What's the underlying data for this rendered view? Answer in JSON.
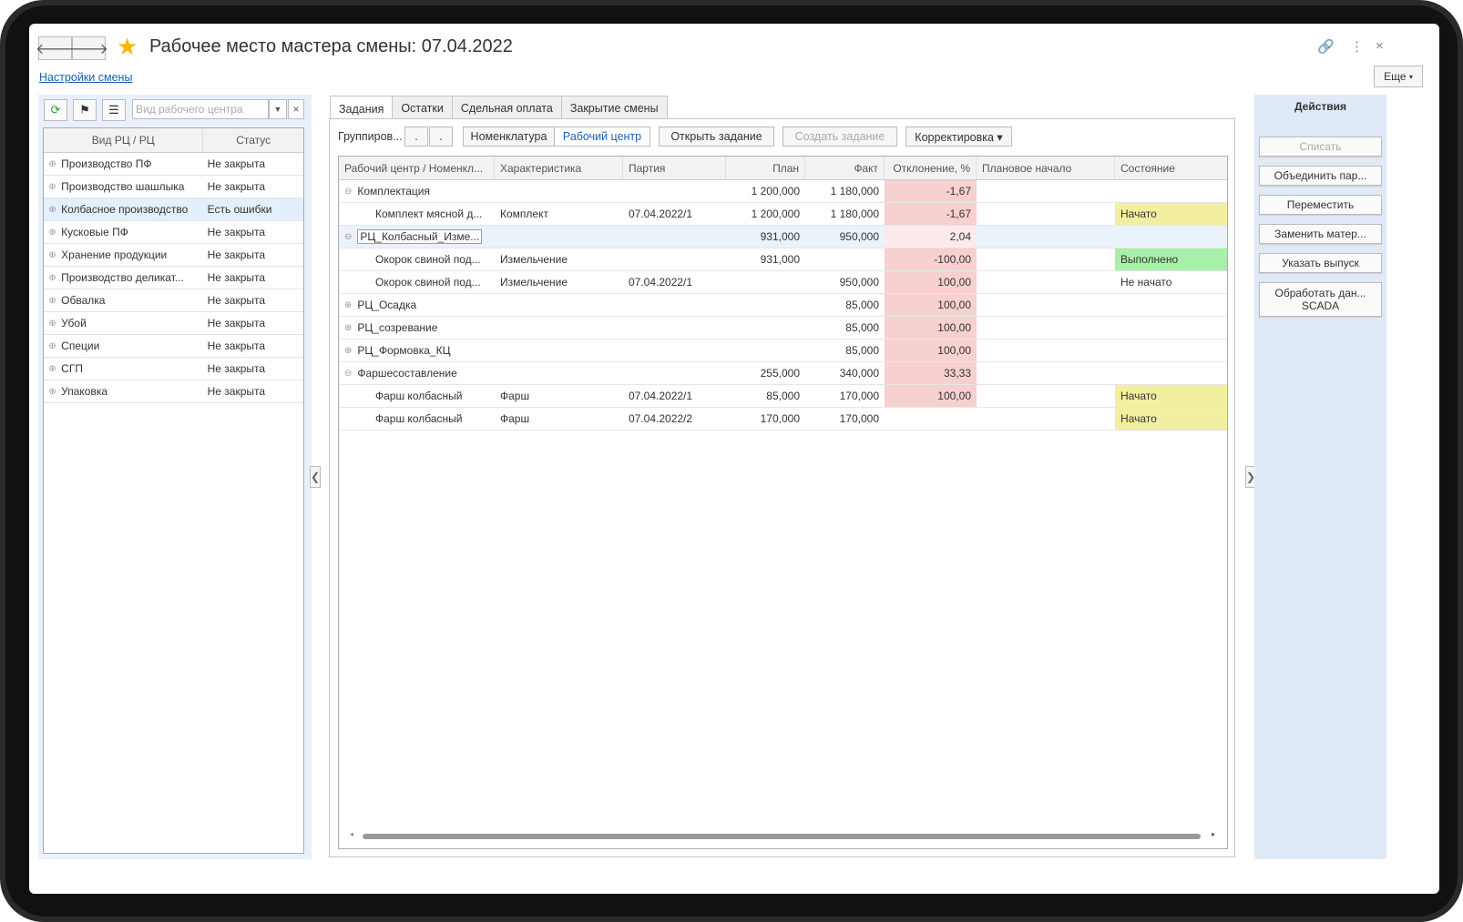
{
  "window": {
    "title": "Рабочее место мастера смены: 07.04.2022"
  },
  "header": {
    "settings_link": "Настройки смены",
    "more_button": "Еще"
  },
  "left_panel": {
    "search_placeholder": "Вид рабочего центра",
    "columns": [
      "Вид РЦ / РЦ",
      "Статус"
    ],
    "rows": [
      {
        "name": "Производство ПФ",
        "status": "Не закрыта"
      },
      {
        "name": "Производство шашлыка",
        "status": "Не закрыта"
      },
      {
        "name": "Колбасное производство",
        "status": "Есть ошибки"
      },
      {
        "name": "Кусковые ПФ",
        "status": "Не закрыта"
      },
      {
        "name": "Хранение продукции",
        "status": "Не закрыта"
      },
      {
        "name": "Производство деликат...",
        "status": "Не закрыта"
      },
      {
        "name": "Обвалка",
        "status": "Не закрыта"
      },
      {
        "name": "Убой",
        "status": "Не закрыта"
      },
      {
        "name": "Специи",
        "status": "Не закрыта"
      },
      {
        "name": "СГП",
        "status": "Не закрыта"
      },
      {
        "name": "Упаковка",
        "status": "Не закрыта"
      }
    ]
  },
  "tabs": [
    "Задания",
    "Остатки",
    "Сдельная оплата",
    "Закрытие смены"
  ],
  "toolbar": {
    "group_label": "Группиров...",
    "btn_nomenclature": "Номенклатура",
    "btn_workcenter": "Рабочий центр",
    "btn_open": "Открыть задание",
    "btn_create": "Создать задание",
    "btn_correct": "Корректировка ▾"
  },
  "grid": {
    "columns": [
      "Рабочий центр / Номенкл...",
      "Характеристика",
      "Партия",
      "План",
      "Факт",
      "Отклонение, %",
      "Плановое начало",
      "Состояние"
    ],
    "rows": [
      {
        "name": "Комплектация",
        "char": "",
        "batch": "",
        "plan": "1 200,000",
        "fact": "1 180,000",
        "dev": "-1,67",
        "start": "",
        "state": ""
      },
      {
        "name": "Комплект мясной д...",
        "char": "Комплект",
        "batch": "07.04.2022/1",
        "plan": "1 200,000",
        "fact": "1 180,000",
        "dev": "-1,67",
        "start": "",
        "state": "Начато"
      },
      {
        "name": "РЦ_Колбасный_Изме...",
        "char": "",
        "batch": "",
        "plan": "931,000",
        "fact": "950,000",
        "dev": "2,04",
        "start": "",
        "state": ""
      },
      {
        "name": "Окорок свиной под...",
        "char": "Измельчение",
        "batch": "",
        "plan": "931,000",
        "fact": "",
        "dev": "-100,00",
        "start": "",
        "state": "Выполнено"
      },
      {
        "name": "Окорок свиной под...",
        "char": "Измельчение",
        "batch": "07.04.2022/1",
        "plan": "",
        "fact": "950,000",
        "dev": "100,00",
        "start": "",
        "state": "Не начато"
      },
      {
        "name": "РЦ_Осадка",
        "char": "",
        "batch": "",
        "plan": "",
        "fact": "85,000",
        "dev": "100,00",
        "start": "",
        "state": ""
      },
      {
        "name": "РЦ_созревание",
        "char": "",
        "batch": "",
        "plan": "",
        "fact": "85,000",
        "dev": "100,00",
        "start": "",
        "state": ""
      },
      {
        "name": "РЦ_Формовка_КЦ",
        "char": "",
        "batch": "",
        "plan": "",
        "fact": "85,000",
        "dev": "100,00",
        "start": "",
        "state": ""
      },
      {
        "name": "Фаршесоставление",
        "char": "",
        "batch": "",
        "plan": "255,000",
        "fact": "340,000",
        "dev": "33,33",
        "start": "",
        "state": ""
      },
      {
        "name": "Фарш колбасный",
        "char": "Фарш",
        "batch": "07.04.2022/1",
        "plan": "85,000",
        "fact": "170,000",
        "dev": "100,00",
        "start": "",
        "state": "Начато"
      },
      {
        "name": "Фарш колбасный",
        "char": "Фарш",
        "batch": "07.04.2022/2",
        "plan": "170,000",
        "fact": "170,000",
        "dev": "",
        "start": "",
        "state": "Начато"
      }
    ]
  },
  "actions": {
    "title": "Действия",
    "buttons": [
      "Списать",
      "Объединить пар...",
      "Переместить",
      "Заменить матер...",
      "Указать выпуск",
      "Обработать дан... SCADA"
    ]
  }
}
